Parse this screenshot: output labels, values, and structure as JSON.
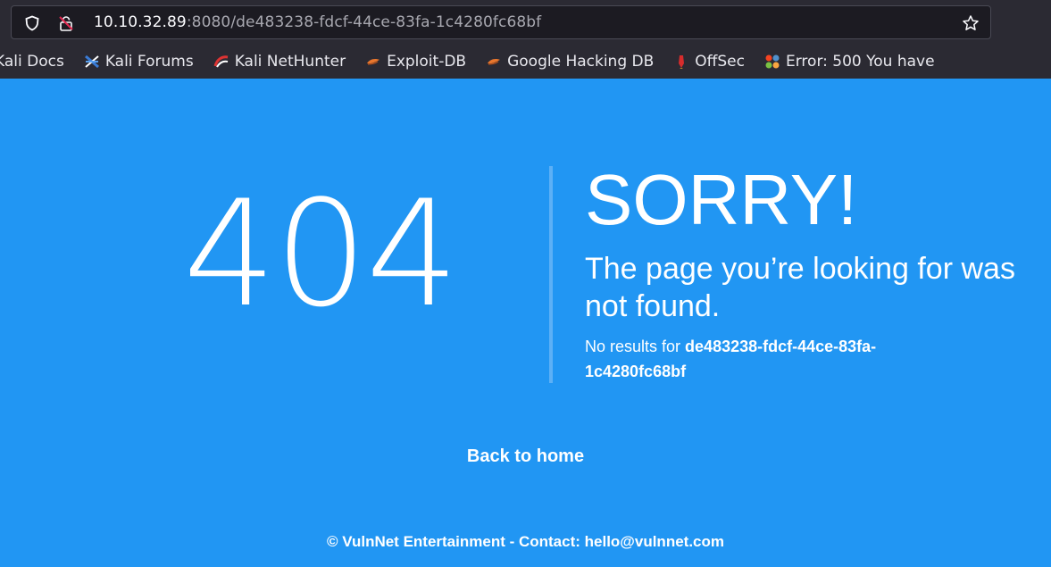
{
  "browser": {
    "url_host": "10.10.32.89",
    "url_rest": ":8080/de483238-fdcf-44ce-83fa-1c4280fc68bf",
    "bookmarks": [
      {
        "label": "Kali Docs",
        "icon": "kali-docs-icon"
      },
      {
        "label": "Kali Forums",
        "icon": "kali-forums-icon"
      },
      {
        "label": "Kali NetHunter",
        "icon": "kali-nethunter-icon"
      },
      {
        "label": "Exploit-DB",
        "icon": "exploit-db-icon"
      },
      {
        "label": "Google Hacking DB",
        "icon": "ghdb-icon"
      },
      {
        "label": "OffSec",
        "icon": "offsec-icon"
      },
      {
        "label": "Error: 500 You have",
        "icon": "joomla-icon"
      }
    ]
  },
  "error": {
    "code": "404",
    "title": "SORRY!",
    "message": "The page you’re looking for was not found.",
    "no_results_prefix": "No results for ",
    "no_results_query": "de483238-fdcf-44ce-83fa-1c4280fc68bf"
  },
  "back_link": "Back to home",
  "footer": "© VulnNet Entertainment - Contact: hello@vulnnet.com",
  "colors": {
    "page_background": "#2196f3",
    "chrome_background": "#2b2a33"
  }
}
